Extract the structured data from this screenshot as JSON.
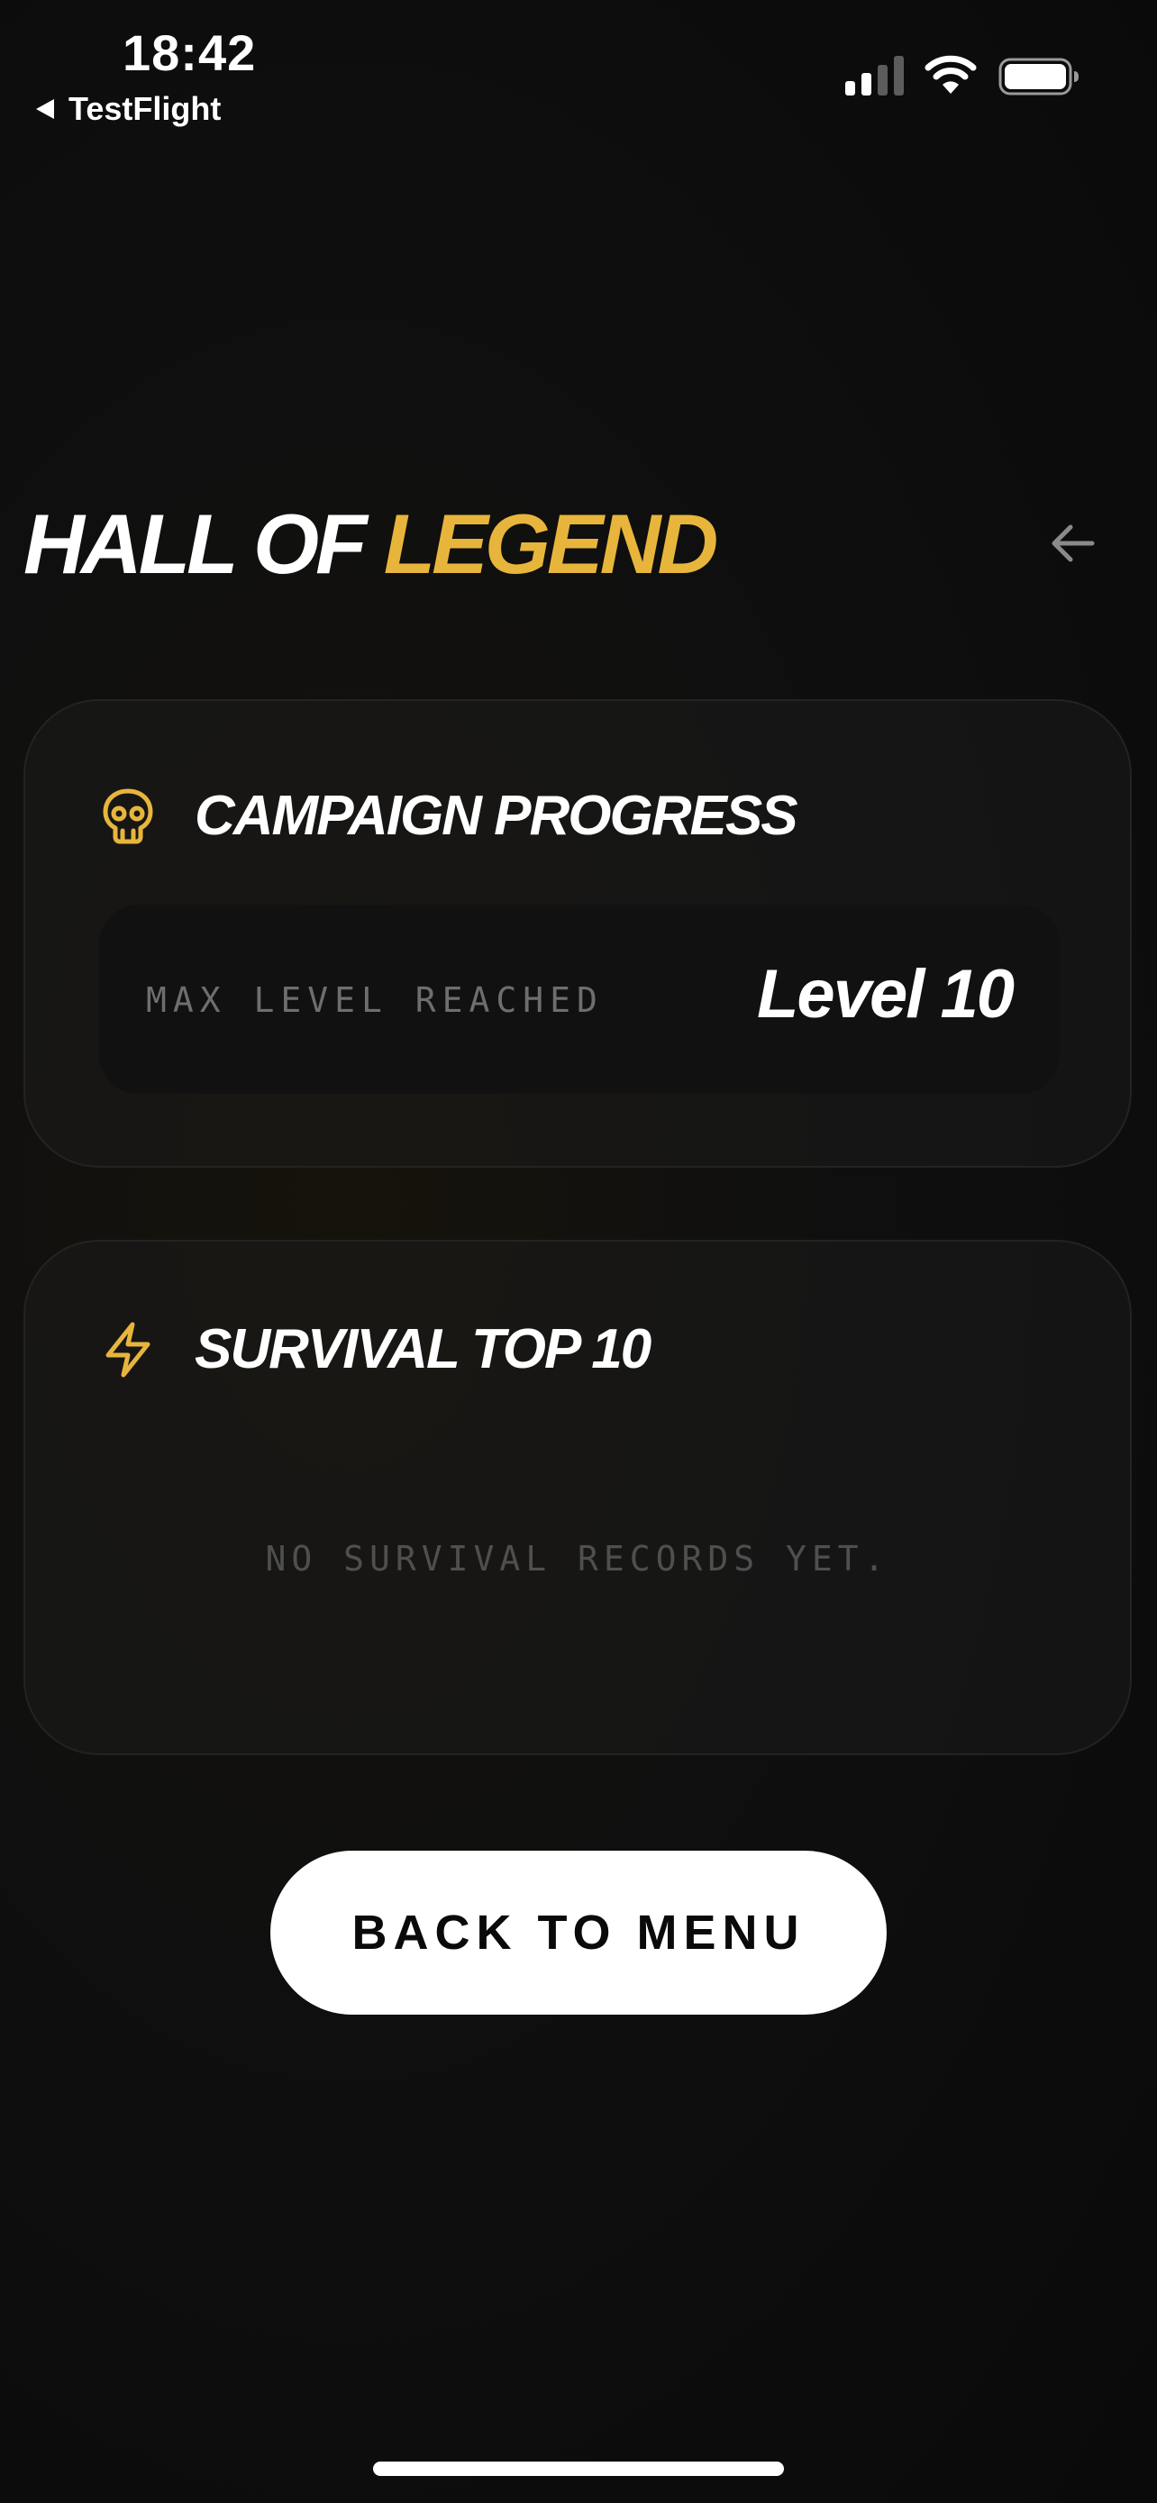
{
  "status_bar": {
    "time": "18:42",
    "back_app": "TestFlight",
    "signal_bars_active": 2,
    "signal_bars_total": 4,
    "battery_level": 1.0,
    "icons": [
      "back-triangle-icon",
      "cellular-signal-icon",
      "wifi-icon",
      "battery-icon"
    ]
  },
  "header": {
    "title_part1": "HALL OF",
    "title_part2": "LEGEND",
    "back_icon": "arrow-left-icon"
  },
  "campaign": {
    "title": "CAMPAIGN PROGRESS",
    "icon": "skull-icon",
    "stat_label": "MAX LEVEL REACHED",
    "stat_value": "Level 10"
  },
  "survival": {
    "title": "SURVIVAL TOP 10",
    "icon": "lightning-bolt-icon",
    "empty_message": "NO SURVIVAL RECORDS YET."
  },
  "back_button": {
    "label": "BACK TO MENU"
  },
  "colors": {
    "accent": "#e8b53c",
    "background": "#0b0b0b",
    "card_border": "#232323",
    "stat_bg": "#111111",
    "muted_text": "#6e6e6e",
    "empty_text": "#4f4f4f",
    "button_bg": "#ffffff",
    "button_text": "#0a0a0a"
  }
}
